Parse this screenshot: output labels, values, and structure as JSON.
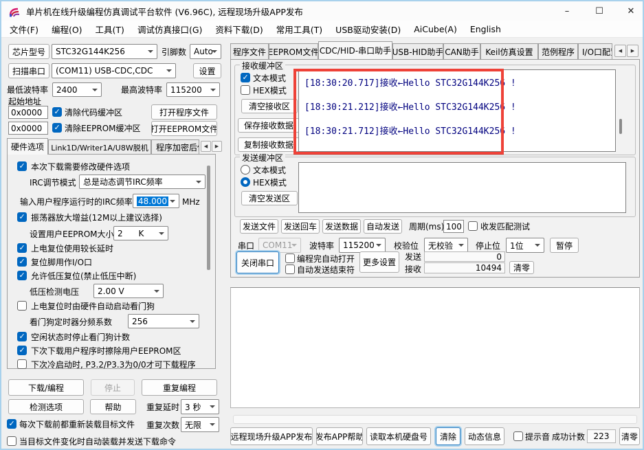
{
  "window": {
    "title": "单片机在线升级编程仿真调试平台软件 (V6.96C), 远程现场升级APP发布",
    "controls": {
      "minimize": "–",
      "maximize": "☐",
      "close": "✕"
    }
  },
  "menu": {
    "items": [
      "文件(F)",
      "编程(O)",
      "工具(T)",
      "调试仿真接口(G)",
      "资料下载(D)",
      "常用工具(T)",
      "USB驱动安装(D)",
      "AiCube(A)",
      "English"
    ]
  },
  "icons": {
    "tab_scroll_left": "◀",
    "tab_scroll_right": "▶"
  },
  "colors": {
    "accent": "#0067c0",
    "highlight_red": "#ee4238",
    "rx_text": "#00007f",
    "window_border": "#a8d1ec"
  },
  "left": {
    "chip": {
      "button": "芯片型号",
      "value": "STC32G144K256",
      "pins_label": "引脚数",
      "pins_value": "Auto"
    },
    "port": {
      "button": "扫描串口",
      "value": "(COM11) USB-CDC,CDC",
      "settings": "设置"
    },
    "baud": {
      "min_label": "最低波特率",
      "min_value": "2400",
      "max_label": "最高波特率",
      "max_value": "115200"
    },
    "address": {
      "title": "起始地址",
      "code_value": "0x0000",
      "code_clear": "清除代码缓冲区",
      "open_program": "打开程序文件",
      "eeprom_value": "0x0000",
      "eeprom_clear": "清除EEPROM缓冲区",
      "open_eeprom": "打开EEPROM文件"
    },
    "tabs": {
      "items": [
        "硬件选项",
        "Link1D/Writer1A/U8W脱机",
        "程序加密后传输"
      ],
      "active": "硬件选项"
    },
    "hw": {
      "modify": {
        "label": "本次下载需要修改硬件选项",
        "checked": true
      },
      "irc_mode_label": "IRC调节模式",
      "irc_mode_value": "总是动态调节IRC频率",
      "irc_freq_label": "输入用户程序运行时的IRC频率",
      "irc_freq_value": "48.000",
      "irc_freq_unit": "MHz",
      "osc_gain": {
        "label": "振荡器放大增益(12M以上建议选择)",
        "checked": true
      },
      "eeprom_size_label": "设置用户EEPROM大小",
      "eeprom_size_value": "2      K",
      "long_delay": {
        "label": "上电复位使用较长延时",
        "checked": true
      },
      "reset_io": {
        "label": "复位脚用作I/O口",
        "checked": true
      },
      "lvr": {
        "label": "允许低压复位(禁止低压中断)",
        "checked": true
      },
      "lvd_label": "低压检测电压",
      "lvd_value": "2.00 V",
      "wdt_auto": {
        "label": "上电复位时由硬件自动启动看门狗",
        "checked": false
      },
      "wdt_div_label": "看门狗定时器分频系数",
      "wdt_div_value": "256",
      "wdt_idle": {
        "label": "空闲状态时停止看门狗计数",
        "checked": true
      },
      "erase_eeprom": {
        "label": "下次下载用户程序时擦除用户EEPROM区",
        "checked": true
      },
      "cold_boot": {
        "label": "下次冷启动时, P3.2/P3.3为0/0才可下载程序",
        "checked": false
      }
    },
    "actions": {
      "download": "下载/编程",
      "stop": "停止",
      "reprogram": "重复编程",
      "check": "检测选项",
      "help": "帮助",
      "delay_label": "重复延时",
      "delay_value": "3 秒",
      "reload": {
        "label": "每次下载前都重新装载目标文件",
        "checked": true
      },
      "count_label": "重复次数",
      "count_value": "无限",
      "autoload": {
        "label": "当目标文件变化时自动装载并发送下载命令",
        "checked": false
      }
    }
  },
  "right": {
    "tabs": {
      "items": [
        "程序文件",
        "EEPROM文件",
        "CDC/HID-串口助手",
        "USB-HID助手",
        "CAN助手",
        "Keil仿真设置",
        "范例程序",
        "I/O口配置"
      ],
      "active": "CDC/HID-串口助手"
    },
    "rx": {
      "title": "接收缓冲区",
      "text_mode": {
        "label": "文本模式",
        "checked": true
      },
      "hex_mode": {
        "label": "HEX模式",
        "checked": false
      },
      "clear": "清空接收区",
      "save": "保存接收数据",
      "copy": "复制接收数据",
      "lines": [
        "[18:30:20.717]接收←Hello STC32G144K256 !",
        "[18:30:21.212]接收←Hello STC32G144K256 !",
        "[18:30:21.712]接收←Hello STC32G144K256 !"
      ]
    },
    "tx": {
      "title": "发送缓冲区",
      "text_mode": {
        "label": "文本模式",
        "selected": false
      },
      "hex_mode": {
        "label": "HEX模式",
        "selected": true
      },
      "clear": "清空发送区",
      "send_file": "发送文件",
      "send_cr": "发送回车",
      "send_data": "发送数据",
      "auto_send": "自动发送",
      "period_label": "周期(ms)",
      "period_value": "100",
      "match_test": {
        "label": "收发匹配测试",
        "checked": false
      }
    },
    "serial": {
      "port_label": "串口",
      "port_value": "COM11",
      "baud_label": "波特率",
      "baud_value": "115200",
      "parity_label": "校验位",
      "parity_value": "无校验",
      "stop_label": "停止位",
      "stop_value": "1位",
      "pause": "暂停",
      "close": "关闭串口",
      "auto_open": {
        "label": "编程完自动打开",
        "checked": false
      },
      "auto_end": {
        "label": "自动发送结束符",
        "checked": false
      },
      "more": "更多设置",
      "tx_label": "发送",
      "tx_count": "0",
      "rx_label": "接收",
      "rx_count": "10494",
      "clear_count": "清零"
    },
    "bottom": {
      "publish": "远程现场升级APP发布",
      "publish_help": "发布APP帮助",
      "read_disk": "读取本机硬盘号",
      "clear": "清除",
      "dynamic": "动态信息",
      "beep": {
        "label": "提示音",
        "checked": false
      },
      "success_label": "成功计数",
      "success_value": "223",
      "clear_zero": "清零"
    }
  }
}
